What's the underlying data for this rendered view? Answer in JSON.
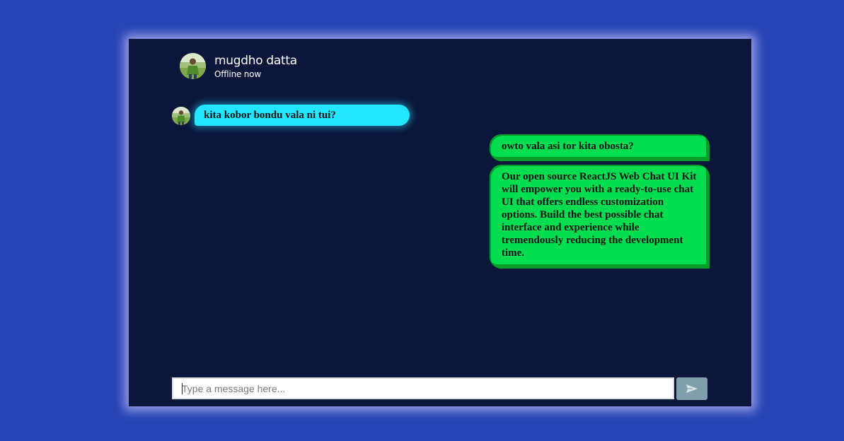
{
  "contact": {
    "name": "mugdho datta",
    "status": "Offline now",
    "avatar_icon": "user-photo-avatar-icon"
  },
  "messages": [
    {
      "direction": "incoming",
      "text": "kita kobor bondu vala ni tui?",
      "color": "#22e5ff"
    },
    {
      "direction": "outgoing",
      "text": "owto vala asi tor kita obosta?",
      "color": "#03dd4f"
    },
    {
      "direction": "outgoing",
      "text": "Our open source ReactJS Web Chat UI Kit will empower you with a ready-to-use chat UI that offers endless customization options. Build the best possible chat interface and experience while tremendously reducing the development time.",
      "color": "#03dd4f"
    }
  ],
  "composer": {
    "placeholder": "Type a message here...",
    "value": ""
  },
  "send_button": {
    "icon": "send-arrow-icon"
  },
  "colors": {
    "page_background": "#2744b5",
    "window_background": "#0c163b",
    "send_button": "#7f9fac"
  }
}
